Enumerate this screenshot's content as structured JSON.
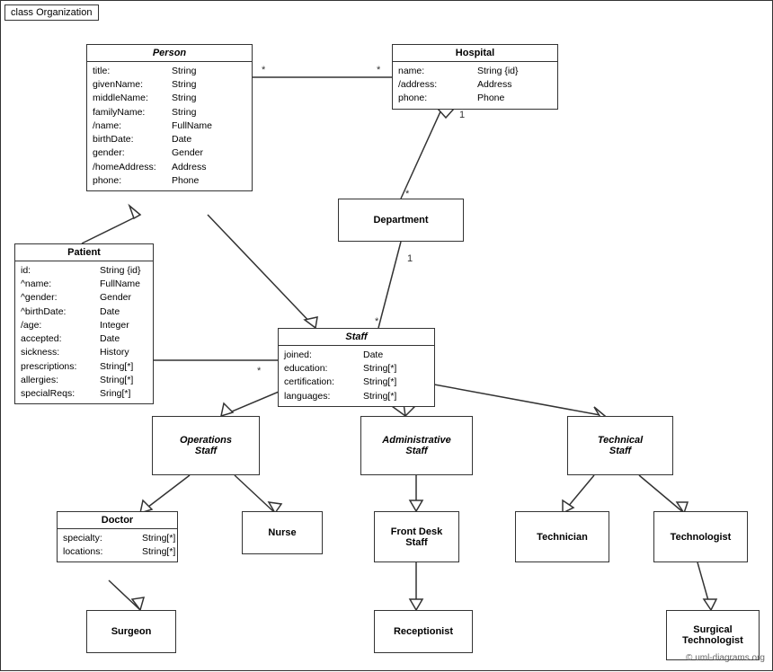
{
  "diagram": {
    "title": "class Organization",
    "copyright": "© uml-diagrams.org",
    "classes": {
      "person": {
        "name": "Person",
        "italic": true,
        "attrs": [
          {
            "name": "title:",
            "type": "String"
          },
          {
            "name": "givenName:",
            "type": "String"
          },
          {
            "name": "middleName:",
            "type": "String"
          },
          {
            "name": "familyName:",
            "type": "String"
          },
          {
            "name": "/name:",
            "type": "FullName"
          },
          {
            "name": "birthDate:",
            "type": "Date"
          },
          {
            "name": "gender:",
            "type": "Gender"
          },
          {
            "name": "/homeAddress:",
            "type": "Address"
          },
          {
            "name": "phone:",
            "type": "Phone"
          }
        ]
      },
      "hospital": {
        "name": "Hospital",
        "italic": false,
        "attrs": [
          {
            "name": "name:",
            "type": "String {id}"
          },
          {
            "name": "/address:",
            "type": "Address"
          },
          {
            "name": "phone:",
            "type": "Phone"
          }
        ]
      },
      "patient": {
        "name": "Patient",
        "italic": false,
        "attrs": [
          {
            "name": "id:",
            "type": "String {id}"
          },
          {
            "name": "^name:",
            "type": "FullName"
          },
          {
            "name": "^gender:",
            "type": "Gender"
          },
          {
            "name": "^birthDate:",
            "type": "Date"
          },
          {
            "name": "/age:",
            "type": "Integer"
          },
          {
            "name": "accepted:",
            "type": "Date"
          },
          {
            "name": "sickness:",
            "type": "History"
          },
          {
            "name": "prescriptions:",
            "type": "String[*]"
          },
          {
            "name": "allergies:",
            "type": "String[*]"
          },
          {
            "name": "specialReqs:",
            "type": "Sring[*]"
          }
        ]
      },
      "department": {
        "name": "Department"
      },
      "staff": {
        "name": "Staff",
        "italic": true,
        "attrs": [
          {
            "name": "joined:",
            "type": "Date"
          },
          {
            "name": "education:",
            "type": "String[*]"
          },
          {
            "name": "certification:",
            "type": "String[*]"
          },
          {
            "name": "languages:",
            "type": "String[*]"
          }
        ]
      },
      "operations_staff": {
        "name": "Operations\nStaff",
        "italic": true
      },
      "administrative_staff": {
        "name": "Administrative\nStaff",
        "italic": true
      },
      "technical_staff": {
        "name": "Technical\nStaff",
        "italic": true
      },
      "doctor": {
        "name": "Doctor",
        "attrs": [
          {
            "name": "specialty:",
            "type": "String[*]"
          },
          {
            "name": "locations:",
            "type": "String[*]"
          }
        ]
      },
      "nurse": {
        "name": "Nurse"
      },
      "front_desk_staff": {
        "name": "Front Desk\nStaff"
      },
      "technician": {
        "name": "Technician"
      },
      "technologist": {
        "name": "Technologist"
      },
      "surgeon": {
        "name": "Surgeon"
      },
      "receptionist": {
        "name": "Receptionist"
      },
      "surgical_technologist": {
        "name": "Surgical\nTechnologist"
      }
    }
  }
}
